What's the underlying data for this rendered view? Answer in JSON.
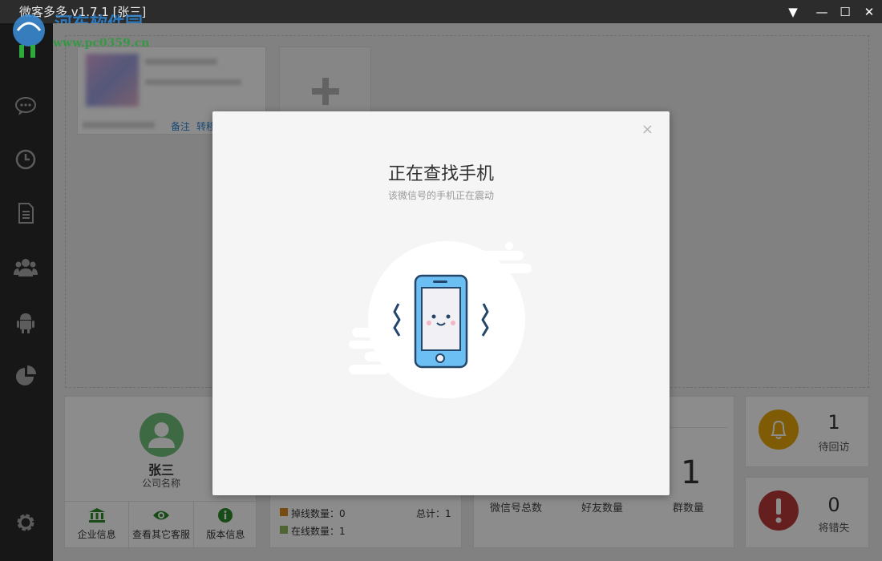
{
  "window": {
    "title": "微客多多 v1.7.1 [张三]",
    "watermark": "河东软件园",
    "watermark_url": "www.pc0359.cn"
  },
  "window_controls": {
    "dropdown": "▼",
    "minimize": "—",
    "maximize": "☐",
    "close": "✕"
  },
  "colors": {
    "accent_blue": "#2f86d6",
    "sidebar_bg": "#2b2b2b",
    "avatar_green": "#6fbf7a",
    "warning_orange": "#e8a60a",
    "danger_red": "#b83a38",
    "offline": "#d98b1e",
    "online": "#8fb85a"
  },
  "sidebar": {
    "items": [
      {
        "icon": "chat-icon"
      },
      {
        "icon": "clock-icon"
      },
      {
        "icon": "document-icon"
      },
      {
        "icon": "users-icon"
      },
      {
        "icon": "android-icon"
      },
      {
        "icon": "pie-chart-icon"
      }
    ],
    "settings_icon": "gear-icon"
  },
  "account_card": {
    "remark_link": "备注",
    "transfer_link": "转移"
  },
  "profile": {
    "name": "张三",
    "company": "公司名称",
    "actions": [
      {
        "label": "企业信息",
        "icon": "bank-icon"
      },
      {
        "label": "查看其它客服",
        "icon": "eye-icon"
      },
      {
        "label": "版本信息",
        "icon": "info-icon"
      }
    ]
  },
  "status_panel": {
    "offline_label": "掉线数量：0",
    "online_label": "在线数量：1",
    "total_label": "总计：1"
  },
  "stats_panel": {
    "group_count": "1",
    "labels": [
      "微信号总数",
      "好友数量",
      "群数量"
    ]
  },
  "pending": {
    "revisit_count": "1",
    "revisit_label": "待回访",
    "lost_count": "0",
    "lost_label": "将错失"
  },
  "modal": {
    "close": "×",
    "title": "正在查找手机",
    "subtitle": "该微信号的手机正在震动"
  }
}
